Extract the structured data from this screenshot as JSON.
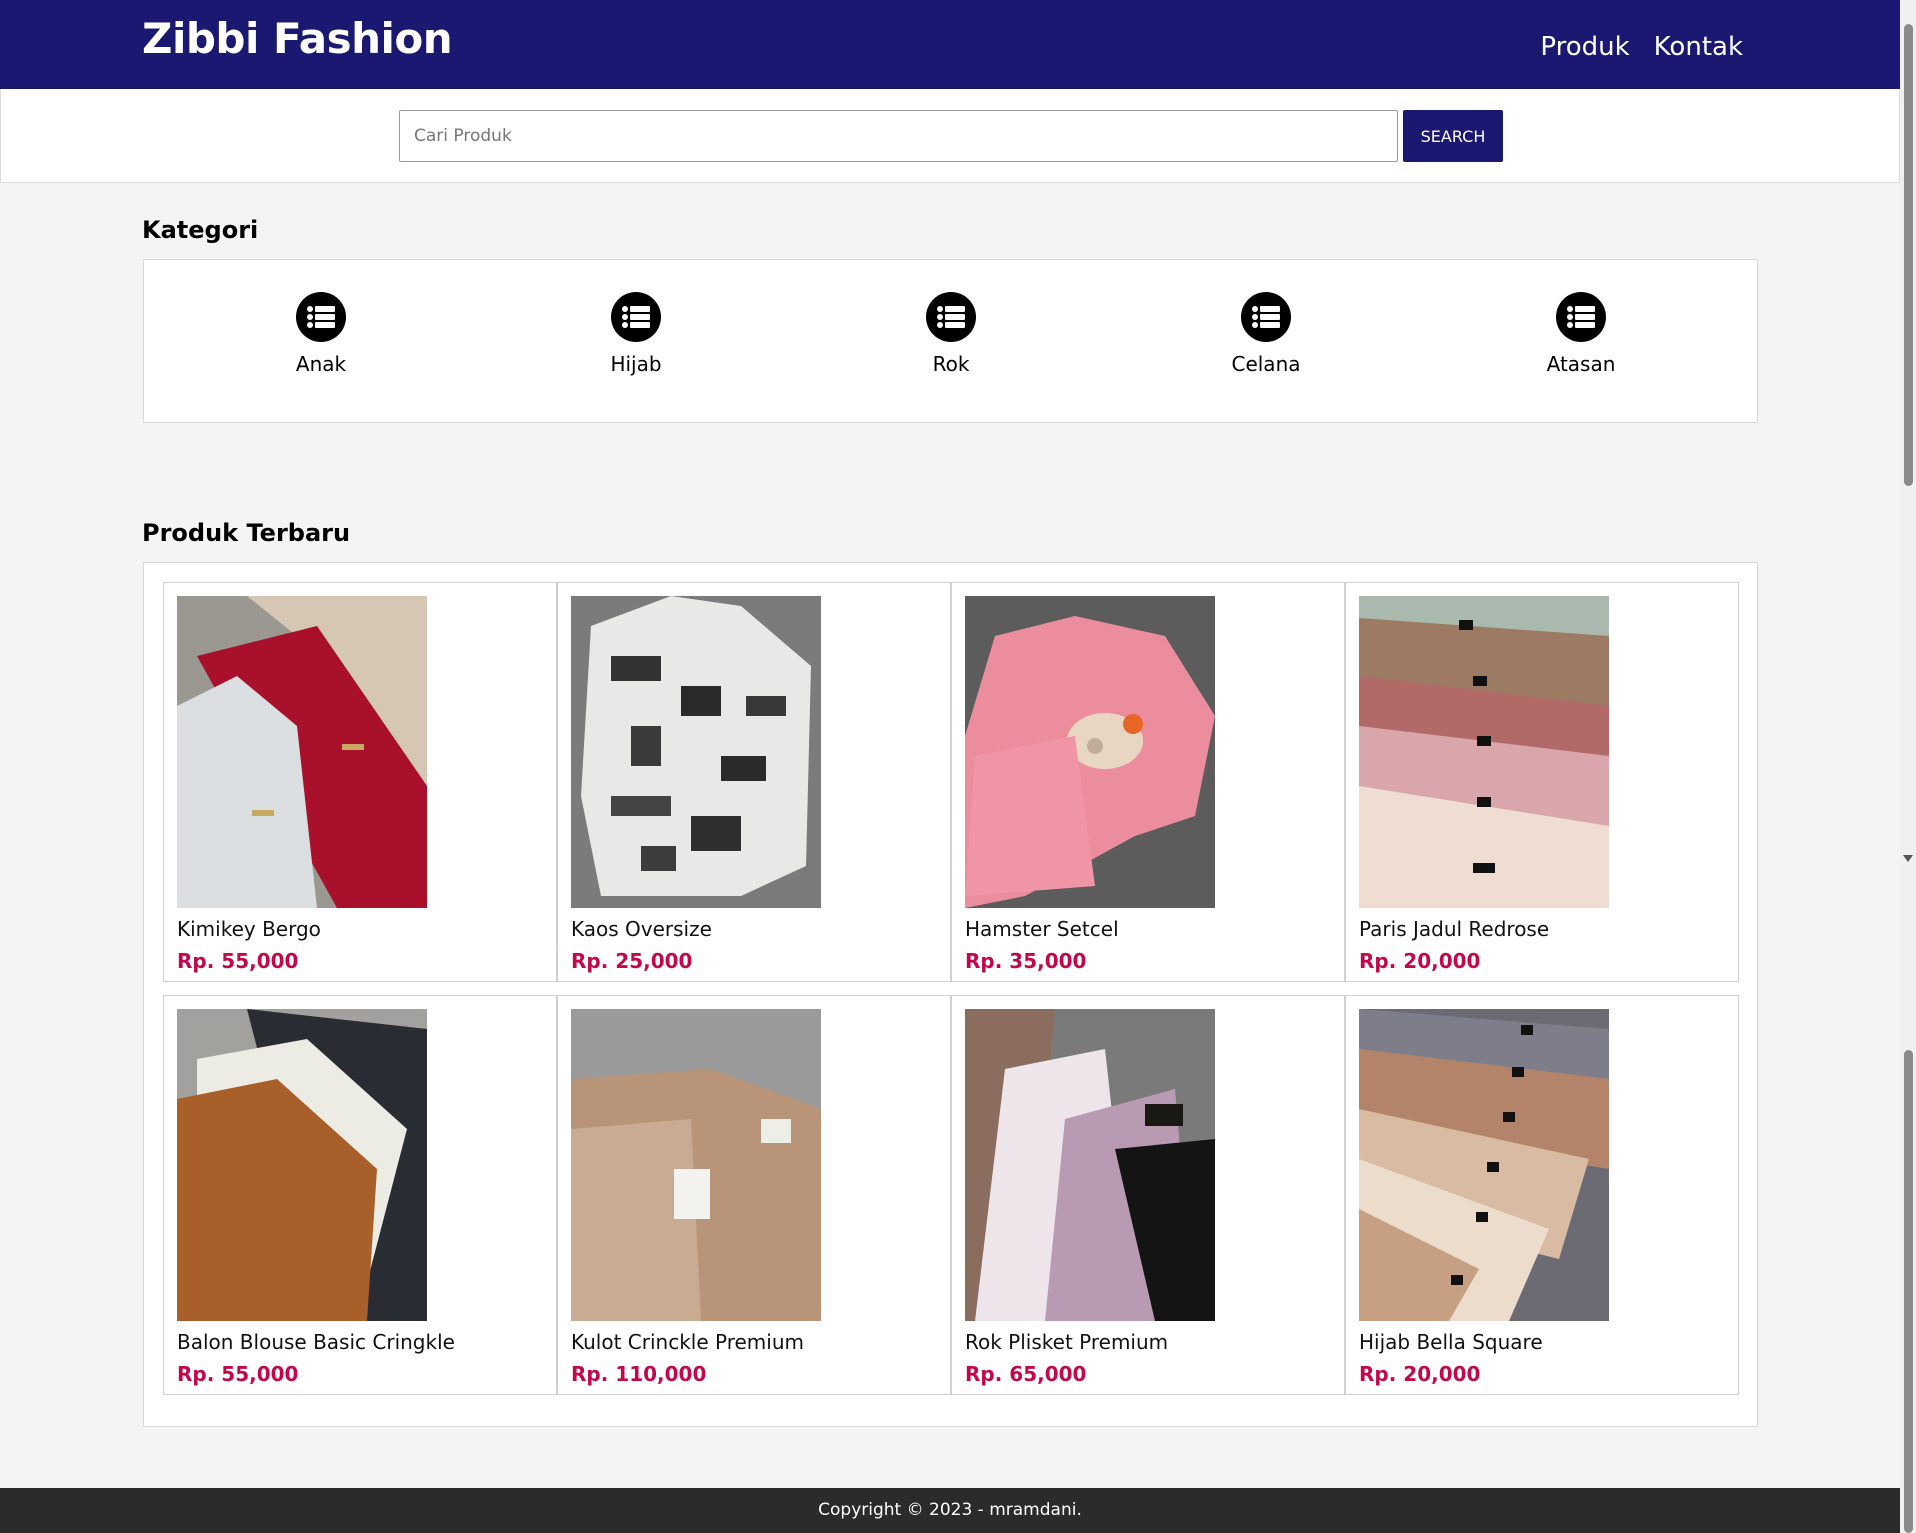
{
  "header": {
    "brand": "Zibbi Fashion",
    "nav": [
      "Produk",
      "Kontak"
    ]
  },
  "search": {
    "placeholder": "Cari Produk",
    "button_label": "SEARCH"
  },
  "categories": {
    "title": "Kategori",
    "items": [
      {
        "label": "Anak",
        "icon": "list-icon"
      },
      {
        "label": "Hijab",
        "icon": "list-icon"
      },
      {
        "label": "Rok",
        "icon": "list-icon"
      },
      {
        "label": "Celana",
        "icon": "list-icon"
      },
      {
        "label": "Atasan",
        "icon": "list-icon"
      }
    ]
  },
  "products": {
    "title": "Produk Terbaru",
    "items": [
      {
        "name": "Kimikey Bergo",
        "price": "Rp. 55,000"
      },
      {
        "name": "Kaos Oversize",
        "price": "Rp. 25,000"
      },
      {
        "name": "Hamster Setcel",
        "price": "Rp. 35,000"
      },
      {
        "name": "Paris Jadul Redrose",
        "price": "Rp. 20,000"
      },
      {
        "name": "Balon Blouse Basic Cringkle",
        "price": "Rp. 55,000"
      },
      {
        "name": "Kulot Crinckle Premium",
        "price": "Rp. 110,000"
      },
      {
        "name": "Rok Plisket Premium",
        "price": "Rp. 65,000"
      },
      {
        "name": "Hijab Bella Square",
        "price": "Rp. 20,000"
      }
    ]
  },
  "footer": {
    "copyright": "Copyright © 2023 - mramdani."
  },
  "colors": {
    "primary": "#1a1870",
    "price": "#c2084d",
    "footer_bg": "#2b2b2b",
    "page_bg": "#f4f4f4"
  }
}
